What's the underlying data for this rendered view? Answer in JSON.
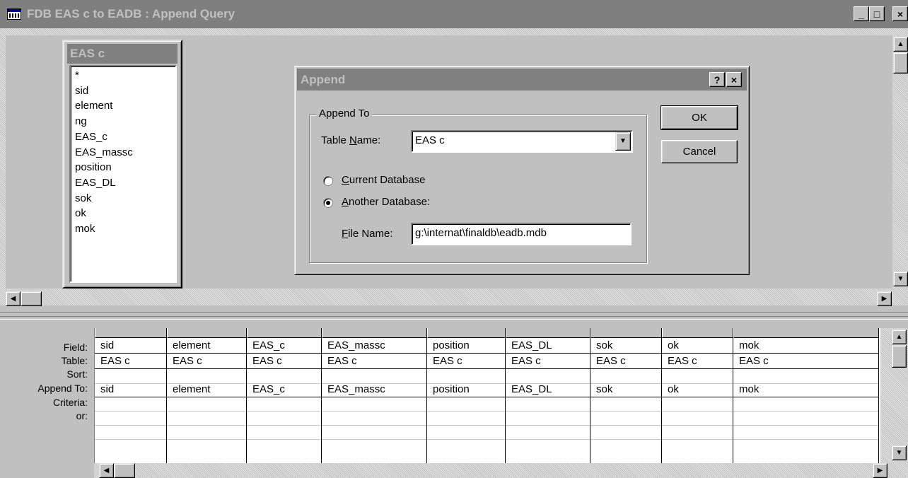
{
  "window": {
    "title": "FDB EAS c to EADB : Append Query",
    "minimize": "_",
    "maximize": "□",
    "close": "×"
  },
  "field_list": {
    "table_name": "EAS c",
    "fields": [
      "*",
      "sid",
      "element",
      "ng",
      "EAS_c",
      "EAS_massc",
      "position",
      "EAS_DL",
      "sok",
      "ok",
      "mok"
    ]
  },
  "grid": {
    "row_labels": [
      "Field:",
      "Table:",
      "Sort:",
      "Append To:",
      "Criteria:",
      "or:"
    ],
    "columns": [
      {
        "field": "sid",
        "table": "EAS c",
        "sort": "",
        "append_to": "sid"
      },
      {
        "field": "element",
        "table": "EAS c",
        "sort": "",
        "append_to": "element"
      },
      {
        "field": "EAS_c",
        "table": "EAS c",
        "sort": "",
        "append_to": "EAS_c"
      },
      {
        "field": "EAS_massc",
        "table": "EAS c",
        "sort": "",
        "append_to": "EAS_massc"
      },
      {
        "field": "position",
        "table": "EAS c",
        "sort": "",
        "append_to": "position"
      },
      {
        "field": "EAS_DL",
        "table": "EAS c",
        "sort": "",
        "append_to": "EAS_DL"
      },
      {
        "field": "sok",
        "table": "EAS c",
        "sort": "",
        "append_to": "sok"
      },
      {
        "field": "ok",
        "table": "EAS c",
        "sort": "",
        "append_to": "ok"
      },
      {
        "field": "mok",
        "table": "EAS c",
        "sort": "",
        "append_to": "mok"
      }
    ]
  },
  "dialog": {
    "title": "Append",
    "help": "?",
    "close": "×",
    "group_label": "Append To",
    "table_name_label_pre": "Table ",
    "table_name_label_key": "N",
    "table_name_label_post": "ame:",
    "table_name_value": "EAS c",
    "current_db_key": "C",
    "current_db_rest": "urrent Database",
    "current_db_selected": false,
    "another_db_key": "A",
    "another_db_rest": "nother Database:",
    "another_db_selected": true,
    "file_name_key": "F",
    "file_name_rest": "ile Name:",
    "file_name_value": "g:\\internat\\finaldb\\eadb.mdb",
    "ok_label": "OK",
    "cancel_label": "Cancel"
  }
}
